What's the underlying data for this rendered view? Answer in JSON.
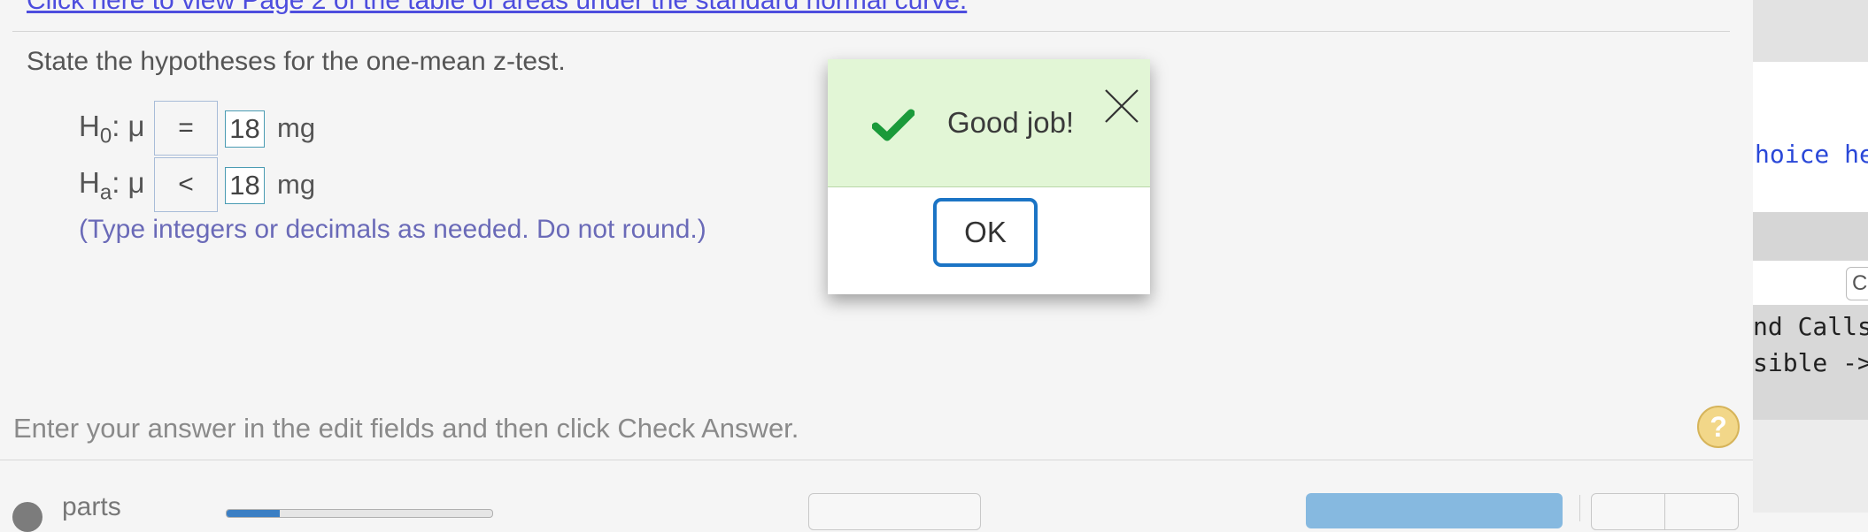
{
  "question": {
    "table_link": "Click here to view Page 2 of the table of areas under the standard normal curve.",
    "prompt": "State the hypotheses for the one-mean z-test.",
    "null_hypothesis": {
      "symbol": "H",
      "subscript": "0",
      "param": ": μ",
      "operator": "=",
      "value": "18",
      "unit": "mg"
    },
    "alt_hypothesis": {
      "symbol": "H",
      "subscript": "a",
      "param": ": μ",
      "operator": "<",
      "value": "18",
      "unit": "mg"
    },
    "hint": "(Type integers or decimals as needed. Do not round.)"
  },
  "footer": {
    "instruction": "Enter your answer in the edit fields and then click Check Answer.",
    "help_label": "?",
    "parts_label": "parts",
    "progress_fraction": 0.2
  },
  "dialog": {
    "message": "Good job!",
    "ok_label": "OK",
    "success_color": "#1a9a3a",
    "header_color": "#e2f6d6"
  },
  "side_panel": {
    "code_line_1": "hoice he",
    "input_value": "C",
    "code_line_2": "nd Calls",
    "code_line_3": "sible ->"
  }
}
